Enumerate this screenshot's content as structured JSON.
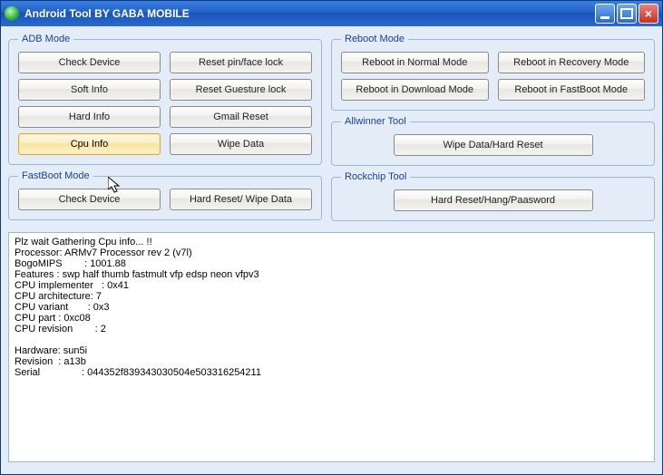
{
  "window": {
    "title": "Android Tool BY GABA MOBILE"
  },
  "adb": {
    "legend": "ADB Mode",
    "check_device": "Check Device",
    "reset_pin": "Reset pin/face lock",
    "soft_info": "Soft Info",
    "reset_gesture": "Reset Guesture lock",
    "hard_info": "Hard Info",
    "gmail_reset": "Gmail Reset",
    "cpu_info": "Cpu Info",
    "wipe_data": "Wipe Data"
  },
  "fastboot": {
    "legend": "FastBoot Mode",
    "check_device": "Check Device",
    "hard_reset": "Hard Reset/ Wipe Data"
  },
  "reboot": {
    "legend": "Reboot Mode",
    "normal": "Reboot in Normal Mode",
    "recovery": "Reboot in Recovery Mode",
    "download": "Reboot in Download Mode",
    "fastboot": "Reboot in FastBoot Mode"
  },
  "allwinner": {
    "legend": "Allwinner Tool",
    "wipe": "Wipe Data/Hard Reset"
  },
  "rockchip": {
    "legend": "Rockchip Tool",
    "hard_reset": "Hard Reset/Hang/Paasword"
  },
  "console": {
    "text": "Plz wait Gathering Cpu info... !!\nProcessor: ARMv7 Processor rev 2 (v7l)\nBogoMIPS        : 1001.88\nFeatures : swp half thumb fastmult vfp edsp neon vfpv3\nCPU implementer   : 0x41\nCPU architecture: 7\nCPU variant       : 0x3\nCPU part : 0xc08\nCPU revision        : 2\n\nHardware: sun5i\nRevision  : a13b\nSerial               : 044352f839343030504e503316254211"
  }
}
